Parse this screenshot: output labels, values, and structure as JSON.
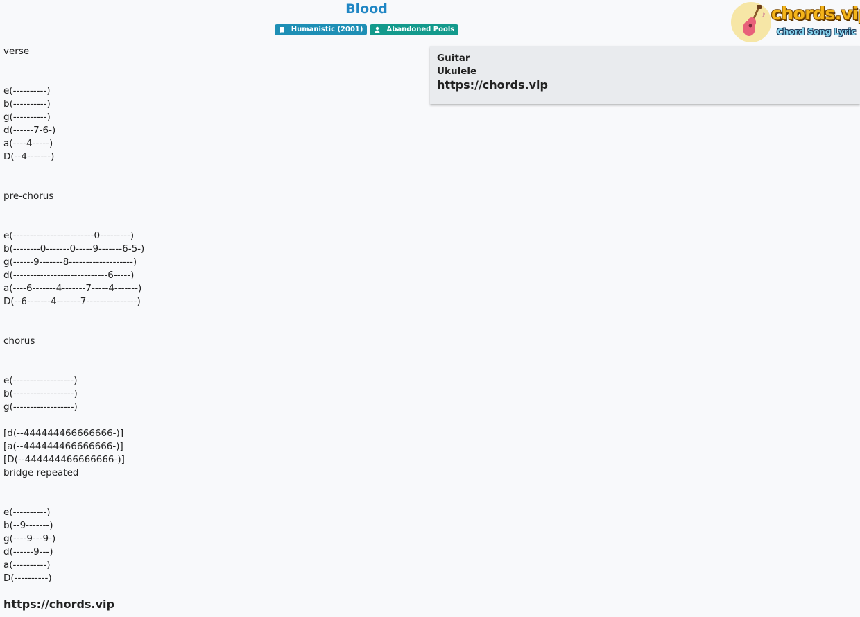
{
  "song": {
    "title": "Blood",
    "album_badge": "Humanistic (2001)",
    "artist_badge": "Abandoned Pools"
  },
  "logo": {
    "word": "chords.vip",
    "tagline": "Chord Song Lyric"
  },
  "instruments": {
    "guitar": "Guitar",
    "ukulele": "Ukulele",
    "site_url": "https://chords.vip"
  },
  "tab_lines": [
    "verse",
    "",
    "",
    "e(----------)",
    "b(----------)",
    "g(----------)",
    "d(------7-6-)",
    "a(----4-----)",
    "D(--4-------)",
    "",
    "",
    "pre-chorus",
    "",
    "",
    "e(------------------------0---------)",
    "b(--------0-------0-----9-------6-5-)",
    "g(------9-------8-------------------)",
    "d(----------------------------6-----)",
    "a(----6-------4-------7-----4-------)",
    "D(--6-------4-------7---------------)",
    "",
    "",
    "chorus",
    "",
    "",
    "e(------------------)",
    "b(------------------)",
    "g(------------------)",
    "",
    "[d(--444444466666666-)]",
    "[a(--444444466666666-)]",
    "[D(--444444466666666-)]",
    "bridge repeated",
    "",
    "",
    "e(----------)",
    "b(--9-------)",
    "g(----9---9-)",
    "d(------9---)",
    "a(----------)",
    "D(----------)"
  ],
  "footer": {
    "url": "https://chords.vip"
  },
  "colors": {
    "title": "#1f86c4",
    "album_badge": "#1e8fb5",
    "artist_badge": "#139a8c",
    "panel_bg": "#e9ebee",
    "page_bg": "#f8f9fb"
  },
  "icons": {
    "album": "book-icon",
    "artist": "user-icon",
    "logo": "guitar-icon"
  }
}
